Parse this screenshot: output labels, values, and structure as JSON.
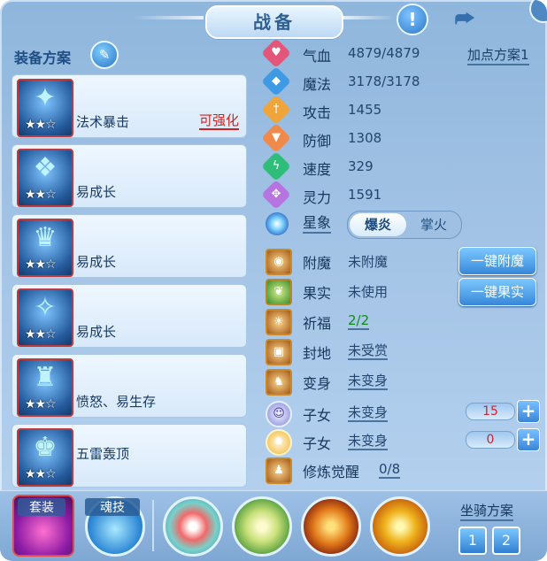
{
  "title": "战备",
  "header": {
    "alert_icon": "exclamation-icon",
    "share_icon": "share-icon"
  },
  "left": {
    "scheme_title": "装备方案",
    "equipment": [
      {
        "stars": "★★☆",
        "name": "法术暴击",
        "tag": "可强化",
        "glyph": "✦"
      },
      {
        "stars": "★★☆",
        "name": "易成长",
        "tag": "",
        "glyph": "❖"
      },
      {
        "stars": "★★☆",
        "name": "易成长",
        "tag": "",
        "glyph": "♛"
      },
      {
        "stars": "★★☆",
        "name": "易成长",
        "tag": "",
        "glyph": "✧"
      },
      {
        "stars": "★★☆",
        "name": "愤怒、易生存",
        "tag": "",
        "glyph": "♜"
      },
      {
        "stars": "★★☆",
        "name": "五雷轰顶",
        "tag": "",
        "glyph": "♚"
      }
    ]
  },
  "stats": [
    {
      "label": "气血",
      "value": "4879/4879",
      "color": "#e4557a",
      "icon": "♥"
    },
    {
      "label": "魔法",
      "value": "3178/3178",
      "color": "#3e9ae4",
      "icon": "◆"
    },
    {
      "label": "攻击",
      "value": "1455",
      "color": "#f0a53a",
      "icon": "†"
    },
    {
      "label": "防御",
      "value": "1308",
      "color": "#f08a4a",
      "icon": "▼"
    },
    {
      "label": "速度",
      "value": "329",
      "color": "#2fbe7a",
      "icon": "ϟ"
    },
    {
      "label": "灵力",
      "value": "1591",
      "color": "#b574e0",
      "icon": "✥"
    }
  ],
  "plan_button": "加点方案1",
  "xingxiang": {
    "label": "星象",
    "options": [
      "爆炎",
      "掌火"
    ],
    "selected": "爆炎"
  },
  "rows": [
    {
      "label": "附魔",
      "value": "未附魔",
      "button": "一键附魔"
    },
    {
      "label": "果实",
      "value": "未使用",
      "button": "一键果实"
    },
    {
      "label": "祈福",
      "value": "2/2"
    },
    {
      "label": "封地",
      "value": "未受赏"
    },
    {
      "label": "变身",
      "value": "未变身"
    },
    {
      "label": "子女",
      "value": "未变身",
      "count": "15"
    },
    {
      "label": "子女",
      "value": "未变身",
      "count": "0"
    },
    {
      "label": "修炼觉醒",
      "value": "0/8"
    }
  ],
  "bottom": {
    "suit_label": "套装",
    "soul_label": "魂技",
    "mount_label": "坐骑方案",
    "mount_buttons": [
      "1",
      "2"
    ]
  }
}
